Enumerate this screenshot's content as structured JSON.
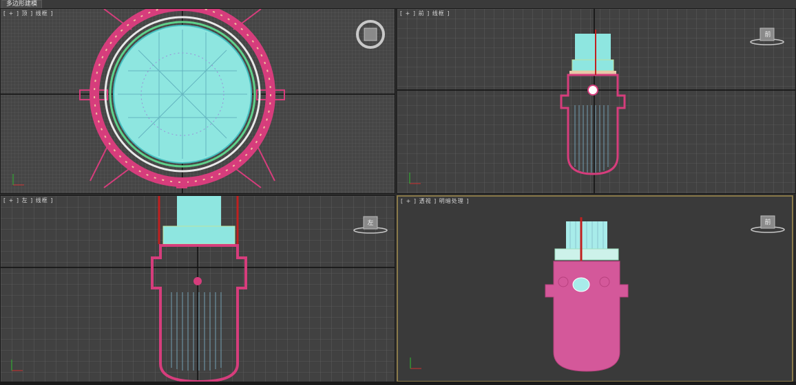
{
  "ribbon": {
    "tab_label": "多边形建模"
  },
  "viewports": {
    "top": {
      "label": "[ + ] 顶 ] 线框 ]",
      "cube_label": "顶"
    },
    "front": {
      "label": "[ + ] 前 ] 线框 ]",
      "cube_label": "前"
    },
    "left": {
      "label": "[ + ] 左 ] 线框 ]",
      "cube_label": "左"
    },
    "persp": {
      "label": "[ + ] 透视 ] 明暗处理 ]",
      "cube_label": "前"
    }
  },
  "colors": {
    "grid_bg": "#414141",
    "vessel": "#d63d7c",
    "vessel_shaded": "#d4589a",
    "core": "#8ee6e0",
    "active_border": "#8a7a4a"
  }
}
